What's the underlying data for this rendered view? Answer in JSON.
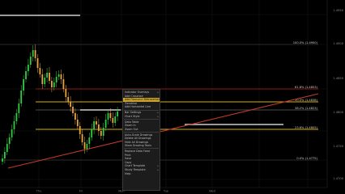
{
  "chart": {
    "price_ticks": [
      "1.4950",
      "1.4900",
      "1.4850",
      "1.4800",
      "1.4750",
      "1.4700"
    ],
    "fib_tags": [
      "100.0% (1.4900)",
      "61.8% (1.4853)",
      "50.0% (1.4838)",
      "38.2% (1.4823)",
      "23.6% (1.4805)",
      "0.0% (1.4775)"
    ],
    "date_ticks": [
      "Thu",
      "Fri",
      "Mon",
      "Tue",
      "Wed"
    ],
    "colors": {
      "up_candle": "#2ecc40",
      "down_candle": "#e8a33d",
      "fib_line": "#8b1a1a",
      "trendline": "#c0392b",
      "highlight_line": "#d4b106"
    }
  },
  "context_menu": {
    "items": [
      {
        "label": "Indicator Overlays",
        "has_submenu": true
      },
      {
        "label": "Add Crosshair",
        "has_submenu": false
      },
      {
        "label": "Add Fibonacci Retracement",
        "has_submenu": false,
        "highlighted": true
      },
      {
        "label": "Trendline",
        "has_submenu": false
      },
      {
        "label": "Add Horizontal Line",
        "has_submenu": false
      },
      {
        "separator": true
      },
      {
        "label": "Bar Settings",
        "has_submenu": true
      },
      {
        "label": "Chart Style",
        "has_submenu": true
      },
      {
        "separator": true
      },
      {
        "label": "Data Table",
        "has_submenu": false
      },
      {
        "label": "Zoom In",
        "has_submenu": false
      },
      {
        "label": "Zoom Out",
        "has_submenu": false
      },
      {
        "separator": true
      },
      {
        "label": "Auto-Scale Drawings",
        "has_submenu": false
      },
      {
        "label": "Delete All Drawings",
        "has_submenu": false
      },
      {
        "label": "Hide All Drawings",
        "has_submenu": false
      },
      {
        "label": "Show Drawing Tools",
        "has_submenu": false
      },
      {
        "separator": true
      },
      {
        "label": "Replace Data Feed",
        "has_submenu": false
      },
      {
        "label": "Print",
        "has_submenu": false
      },
      {
        "label": "Save",
        "has_submenu": false
      },
      {
        "label": "Copy",
        "has_submenu": false
      },
      {
        "label": "Chart Template",
        "has_submenu": true
      },
      {
        "label": "Study Template",
        "has_submenu": true
      },
      {
        "label": "Help",
        "has_submenu": false
      }
    ]
  }
}
